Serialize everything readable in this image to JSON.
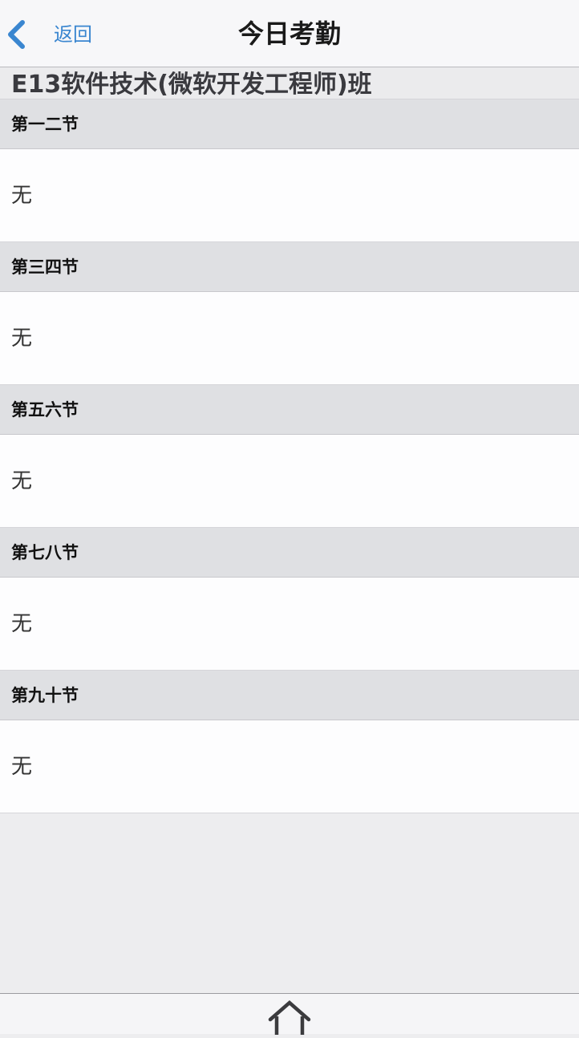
{
  "navbar": {
    "back_label": "返回",
    "title": "今日考勤"
  },
  "class_name": "E13软件技术(微软开发工程师)班",
  "sections": [
    {
      "heading": "第一二节",
      "content": "无"
    },
    {
      "heading": "第三四节",
      "content": "无"
    },
    {
      "heading": "第五六节",
      "content": "无"
    },
    {
      "heading": "第七八节",
      "content": "无"
    },
    {
      "heading": "第九十节",
      "content": "无"
    }
  ],
  "colors": {
    "accent": "#3a86d0",
    "section_header_bg": "#dfe0e3",
    "page_bg": "#ededef"
  },
  "icons": {
    "back": "chevron-left-icon",
    "home": "home-icon"
  }
}
